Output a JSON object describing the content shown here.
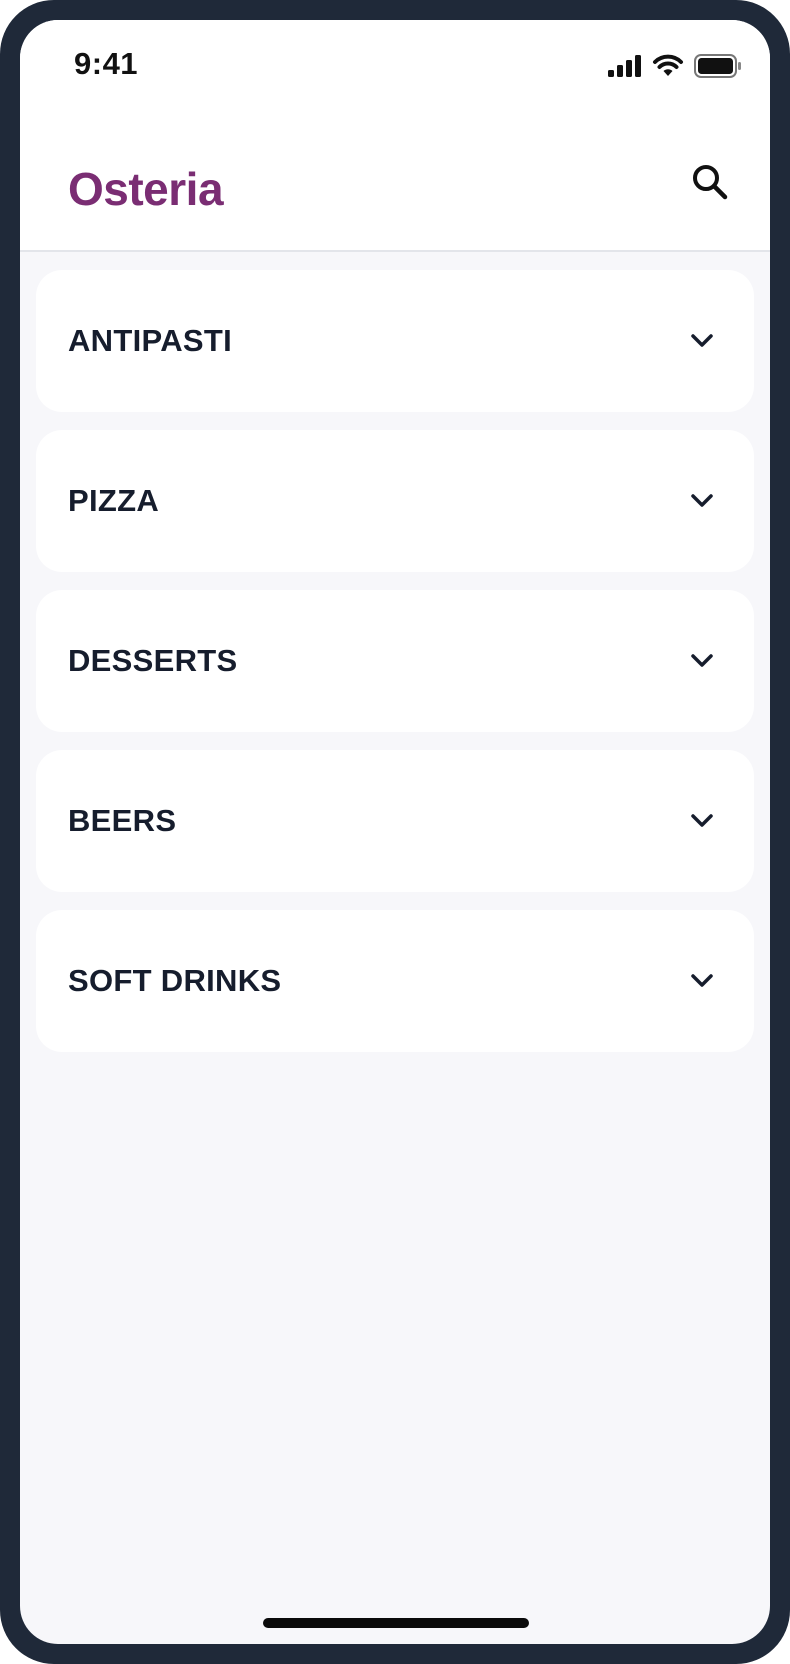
{
  "status_bar": {
    "time": "9:41",
    "icons": [
      "signal-icon",
      "wifi-icon",
      "battery-icon"
    ]
  },
  "header": {
    "title": "Osteria",
    "search_icon": "search-icon"
  },
  "colors": {
    "brand": "#7a2d73",
    "frame": "#1f2939",
    "text": "#161d2d",
    "background": "#f7f7fa"
  },
  "categories": [
    {
      "label": "ANTIPASTI",
      "icon": "chevron-down-icon"
    },
    {
      "label": "PIZZA",
      "icon": "chevron-down-icon"
    },
    {
      "label": "DESSERTS",
      "icon": "chevron-down-icon"
    },
    {
      "label": "BEERS",
      "icon": "chevron-down-icon"
    },
    {
      "label": "SOFT DRINKS",
      "icon": "chevron-down-icon"
    }
  ]
}
